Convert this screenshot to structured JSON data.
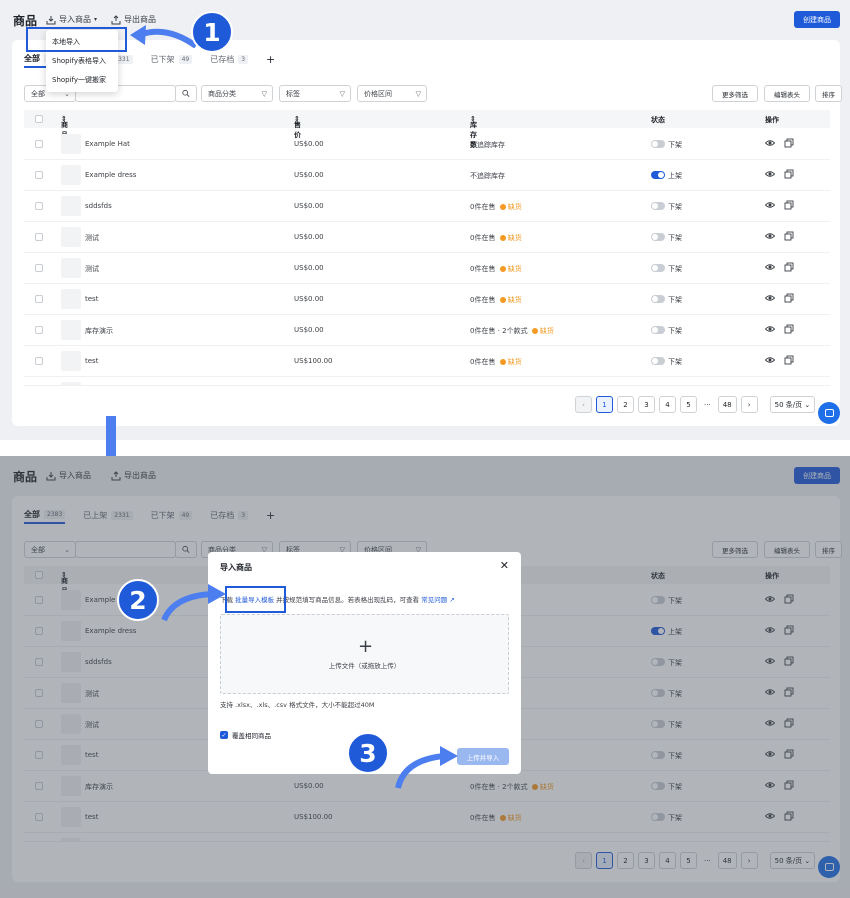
{
  "header": {
    "title": "商品",
    "import_label": "导入商品",
    "export_label": "导出商品",
    "create_label": "创建商品"
  },
  "tabs": [
    {
      "label": "全部",
      "count": "2383"
    },
    {
      "label": "已上架",
      "count": "2331"
    },
    {
      "label": "已下架",
      "count": "49"
    },
    {
      "label": "已存档",
      "count": "3"
    }
  ],
  "tab_add": "+",
  "import_menu": [
    "本地导入",
    "Shopify表格导入",
    "Shopify一键搬家"
  ],
  "filters": {
    "scope": "全部",
    "category": "商品分类",
    "tag": "标签",
    "price": "价格区间",
    "more": "更多筛选",
    "edit_columns": "编辑表头",
    "sort": "排序"
  },
  "columns": {
    "product": "商品",
    "price": "售价",
    "stock": "库存数",
    "status": "状态",
    "actions": "操作"
  },
  "rows": [
    {
      "name": "Example Hat",
      "price": "US$0.00",
      "stock": "不追踪库存",
      "stock_warn": "",
      "status": "下架",
      "on": false
    },
    {
      "name": "Example dress",
      "price": "US$0.00",
      "stock": "不追踪库存",
      "stock_warn": "",
      "status": "上架",
      "on": true
    },
    {
      "name": "sddsfds",
      "price": "US$0.00",
      "stock": "0件在售",
      "stock_warn": "缺货",
      "status": "下架",
      "on": false
    },
    {
      "name": "测试",
      "price": "US$0.00",
      "stock": "0件在售",
      "stock_warn": "缺货",
      "status": "下架",
      "on": false
    },
    {
      "name": "测试",
      "price": "US$0.00",
      "stock": "0件在售",
      "stock_warn": "缺货",
      "status": "下架",
      "on": false
    },
    {
      "name": "test",
      "price": "US$0.00",
      "stock": "0件在售",
      "stock_warn": "缺货",
      "status": "下架",
      "on": false
    },
    {
      "name": "库存演示",
      "price": "US$0.00",
      "stock": "0件在售 · 2个款式",
      "stock_warn": "缺货",
      "status": "下架",
      "on": false
    },
    {
      "name": "test",
      "price": "US$100.00",
      "stock": "0件在售",
      "stock_warn": "缺货",
      "status": "下架",
      "on": false
    }
  ],
  "pagination": {
    "pages": [
      "1",
      "2",
      "3",
      "4",
      "5"
    ],
    "ellipsis": "···",
    "last": "48",
    "prev": "‹",
    "next": "›",
    "per_page": "50 条/页"
  },
  "modal": {
    "title": "导入商品",
    "close": "✕",
    "tip_prefix": "下载",
    "tip_link": "批量导入模板",
    "tip_middle": "并按规范填写商品信息。若表格出现乱码，可查看",
    "tip_faq": "常见问题",
    "upload_plus": "+",
    "upload_text": "上传文件（或拖放上传）",
    "support_text": "支持 .xlsx、.xls、.csv 格式文件，大小不能超过40M",
    "checkbox_label": "覆盖相同商品",
    "submit_label": "上传并导入"
  },
  "steps": [
    "1",
    "2",
    "3"
  ],
  "colors": {
    "primary": "#1f5bd9",
    "warning": "#f59a23",
    "chat": "#1f6fe8"
  }
}
